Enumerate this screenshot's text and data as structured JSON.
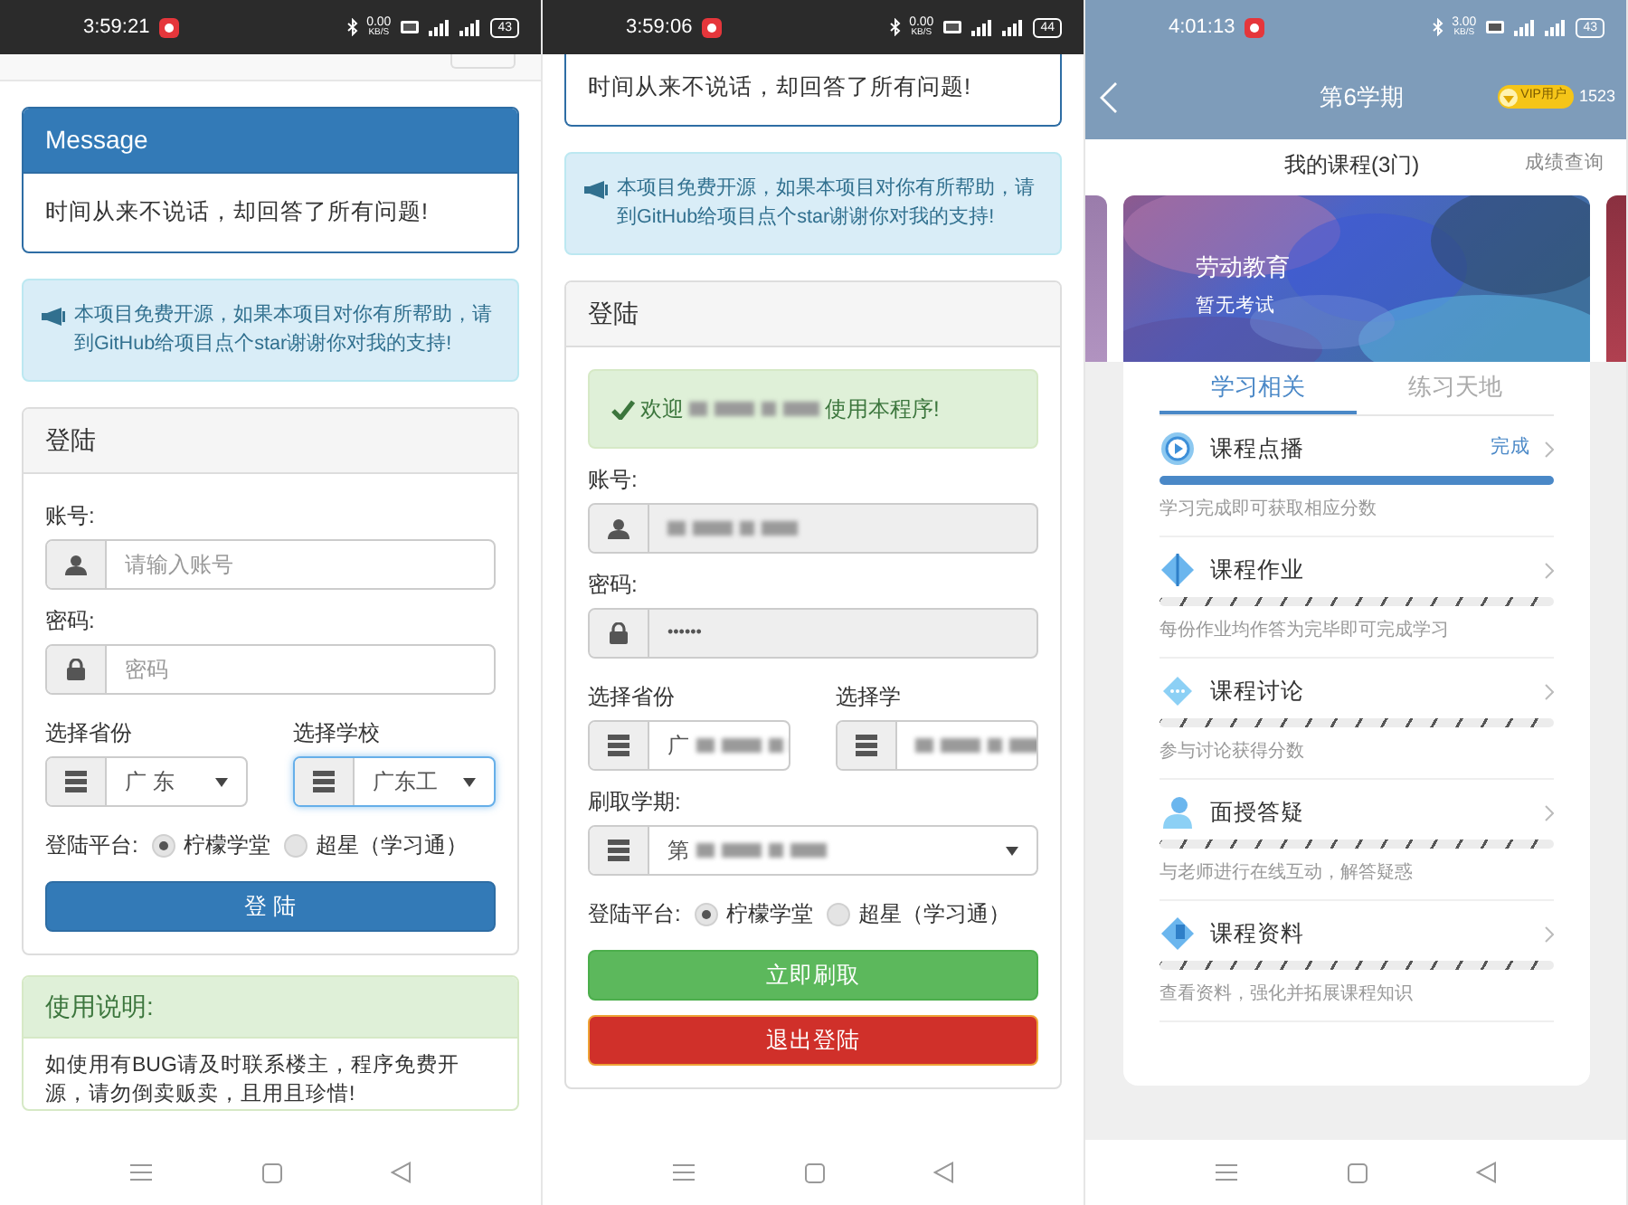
{
  "phones": [
    {
      "kind": "web",
      "status_bar": {
        "time": "3:59:21",
        "speed": "0.00",
        "speed_unit": "KB/S",
        "battery": "43"
      },
      "blocks": [
        {
          "kind": "navbar"
        },
        {
          "kind": "message",
          "title": "Message",
          "text": "时间从来不说话，却回答了所有问题!"
        },
        {
          "kind": "alert",
          "text": "本项目免费开源，如果本项目对你有所帮助，请到GitHub给项目点个star谢谢你对我的支持!"
        },
        {
          "kind": "login",
          "title": "登陆",
          "rows": [
            {
              "kind": "account",
              "label": "账号:",
              "placeholder": "请输入账号",
              "disabled": false
            },
            {
              "kind": "password",
              "label": "密码:",
              "placeholder": "密码",
              "disabled": false
            },
            {
              "kind": "selects",
              "items": [
                {
                  "label": "选择省份",
                  "value": "广 东",
                  "focused": false
                },
                {
                  "label": "选择学校",
                  "value": "广东工",
                  "focused": true
                }
              ]
            },
            {
              "kind": "radios",
              "label": "登陆平台:",
              "options": [
                {
                  "label": "柠檬学堂",
                  "selected": true
                },
                {
                  "label": "超星（学习通）",
                  "selected": false
                }
              ]
            },
            {
              "kind": "submit",
              "label": "登 陆"
            }
          ]
        },
        {
          "kind": "usage",
          "title": "使用说明:",
          "text": "如使用有BUG请及时联系楼主，程序免费开源，请勿倒卖贩卖，且用且珍惜!"
        }
      ]
    },
    {
      "kind": "web",
      "status_bar": {
        "time": "3:59:06",
        "speed": "0.00",
        "speed_unit": "KB/S",
        "battery": "44"
      },
      "blocks": [
        {
          "kind": "message",
          "text": "时间从来不说话，却回答了所有问题!"
        },
        {
          "kind": "alert",
          "text": "本项目免费开源，如果本项目对你有所帮助，请到GitHub给项目点个star谢谢你对我的支持!"
        },
        {
          "kind": "login",
          "title": "登陆",
          "rows": [
            {
              "kind": "welcome",
              "before": "欢迎",
              "after": "使用本程序!",
              "blurred": true
            },
            {
              "kind": "account",
              "label": "账号:",
              "blurred": true,
              "disabled": true
            },
            {
              "kind": "password",
              "label": "密码:",
              "value": "••••••",
              "disabled": true
            },
            {
              "kind": "selects",
              "items": [
                {
                  "label": "选择省份",
                  "value": "广",
                  "blurred": true,
                  "focused": false
                },
                {
                  "label": "选择学",
                  "blurred": true,
                  "focused": false
                }
              ]
            },
            {
              "kind": "select",
              "label": "刷取学期:",
              "value": "第",
              "blurred": true,
              "focused": false
            },
            {
              "kind": "radios",
              "label": "登陆平台:",
              "options": [
                {
                  "label": "柠檬学堂",
                  "selected": true
                },
                {
                  "label": "超星（学习通）",
                  "selected": false
                }
              ]
            },
            {
              "kind": "refresh",
              "label": "立即刷取"
            },
            {
              "kind": "logout",
              "label": "退出登陆"
            }
          ]
        }
      ]
    },
    {
      "kind": "app",
      "status_bar": {
        "time": "4:01:13",
        "speed": "3.00",
        "speed_unit": "KB/S",
        "battery": "43"
      },
      "header": {
        "title": "第6学期",
        "badge": "VIP用户",
        "points": "1523"
      },
      "section": {
        "title": "我的课程(3门)",
        "link": "成绩查询"
      },
      "course": {
        "name": "劳动教育",
        "note": "暂无考试"
      },
      "tabs": [
        {
          "label": "学习相关",
          "selected": true
        },
        {
          "label": "练习天地",
          "selected": false
        }
      ],
      "items": [
        {
          "kind": "play",
          "title": "课程点播",
          "status": "完成",
          "level": 1,
          "text": "学习完成即可获取相应分数"
        },
        {
          "kind": "diamond",
          "title": "课程作业",
          "level": 0,
          "text": "每份作业均作答为完毕即可完成学习"
        },
        {
          "kind": "chat",
          "title": "课程讨论",
          "level": 0,
          "text": "参与讨论获得分数"
        },
        {
          "kind": "person",
          "title": "面授答疑",
          "level": 0,
          "text": "与老师进行在线互动，解答疑惑"
        },
        {
          "kind": "book",
          "title": "课程资料",
          "level": 0,
          "text": "查看资料，强化并拓展课程知识"
        }
      ]
    }
  ]
}
